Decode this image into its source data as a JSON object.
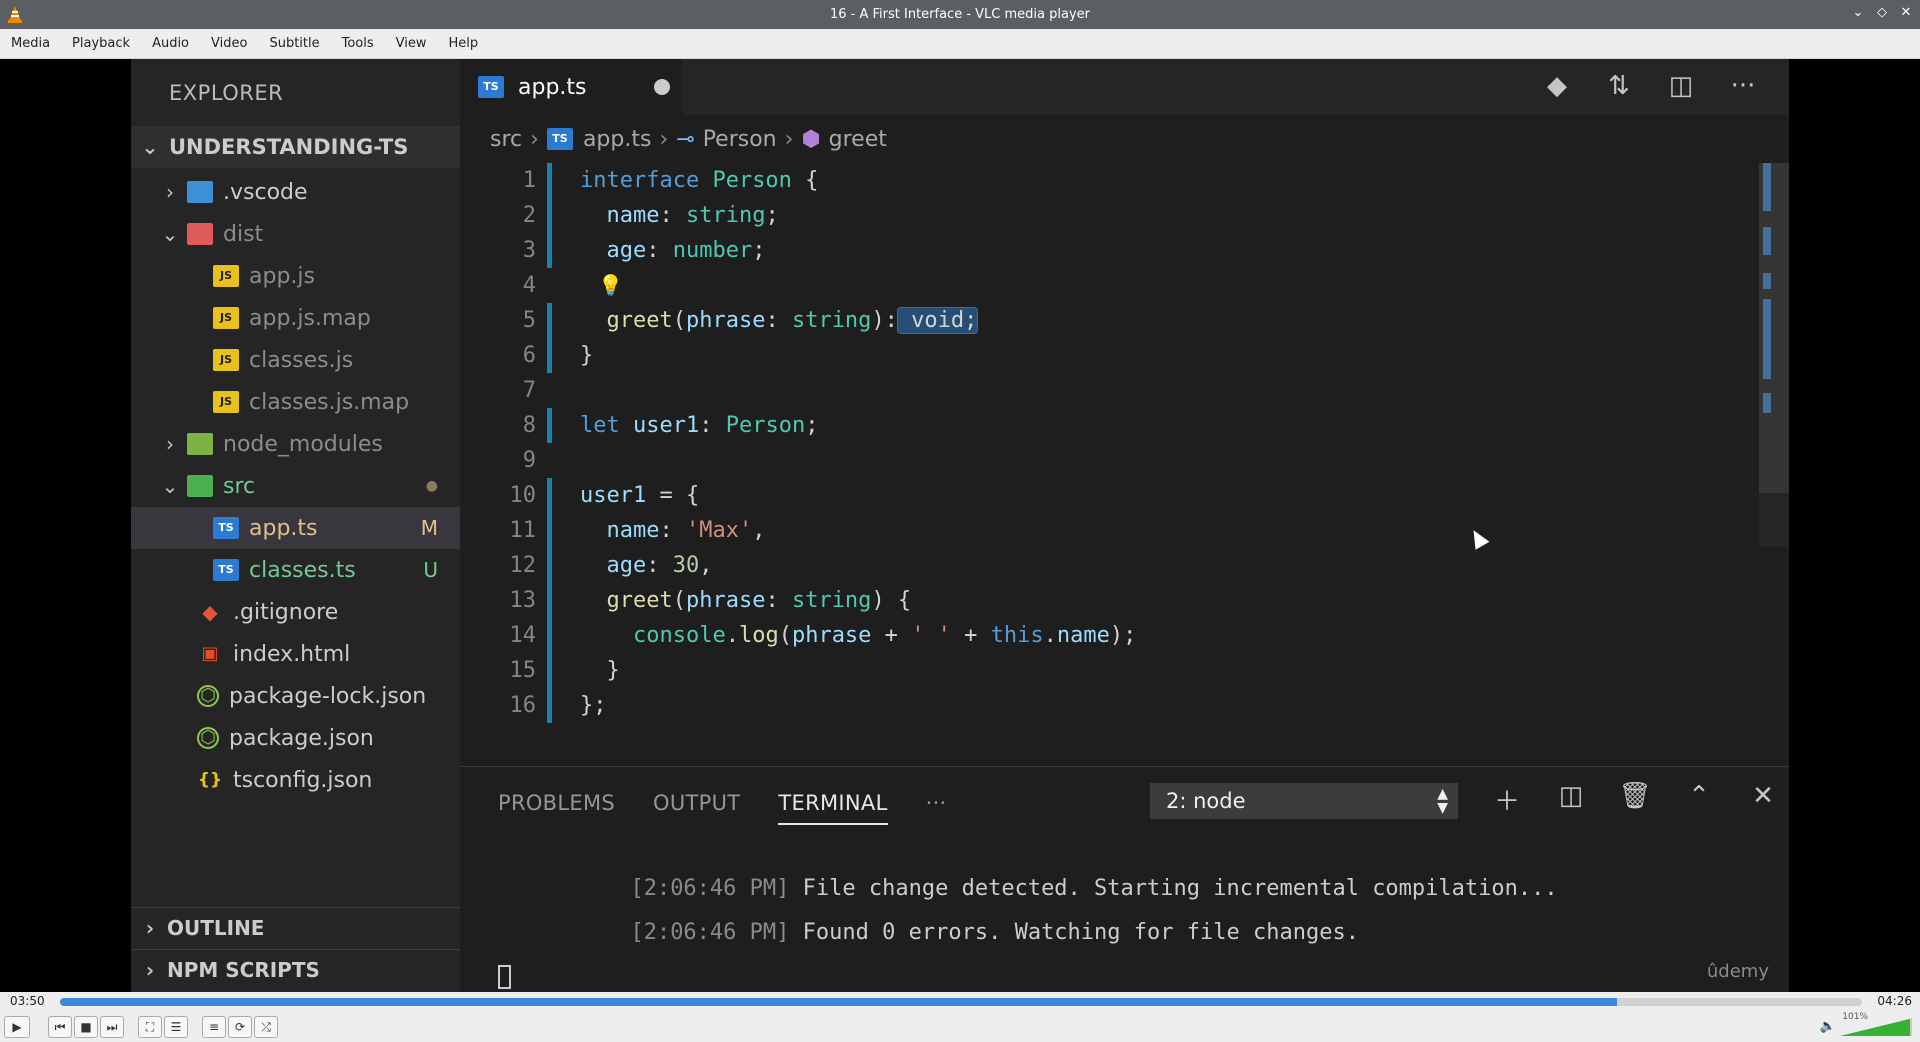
{
  "window": {
    "title": "16 - A First Interface - VLC media player",
    "buttons": [
      "minimize",
      "restore",
      "close"
    ]
  },
  "menu": [
    "Media",
    "Playback",
    "Audio",
    "Video",
    "Subtitle",
    "Tools",
    "View",
    "Help"
  ],
  "vscode": {
    "explorer_title": "EXPLORER",
    "root": "UNDERSTANDING-TS",
    "tree": [
      {
        "label": ".vscode",
        "icon": "vscode-folder-icon",
        "kind": "folder-collapsed"
      },
      {
        "label": "dist",
        "icon": "dist-folder-icon",
        "kind": "folder-open"
      },
      {
        "label": "app.js",
        "icon": "js-file-icon",
        "kind": "file"
      },
      {
        "label": "app.js.map",
        "icon": "js-map-file-icon",
        "kind": "file"
      },
      {
        "label": "classes.js",
        "icon": "js-file-icon",
        "kind": "file"
      },
      {
        "label": "classes.js.map",
        "icon": "js-map-file-icon",
        "kind": "file"
      },
      {
        "label": "node_modules",
        "icon": "node-folder-icon",
        "kind": "folder-collapsed"
      },
      {
        "label": "src",
        "icon": "src-folder-icon",
        "kind": "folder-open"
      },
      {
        "label": "app.ts",
        "icon": "ts-file-icon",
        "kind": "file",
        "badge": "M"
      },
      {
        "label": "classes.ts",
        "icon": "ts-file-icon",
        "kind": "file",
        "badge": "U"
      },
      {
        "label": ".gitignore",
        "icon": "git-icon",
        "kind": "file"
      },
      {
        "label": "index.html",
        "icon": "html-icon",
        "kind": "file"
      },
      {
        "label": "package-lock.json",
        "icon": "node-icon",
        "kind": "file"
      },
      {
        "label": "package.json",
        "icon": "node-icon",
        "kind": "file"
      },
      {
        "label": "tsconfig.json",
        "icon": "json-icon",
        "kind": "file"
      }
    ],
    "sections": [
      "OUTLINE",
      "NPM SCRIPTS"
    ],
    "tab": {
      "label": "app.ts",
      "icon_text": "TS"
    },
    "icon_texts": {
      "js": "JS",
      "ts": "TS"
    },
    "breadcrumb": [
      "src",
      "app.ts",
      "Person",
      "greet"
    ],
    "code_lines": [
      {
        "n": "1",
        "tokens": [
          [
            "kw",
            "interface "
          ],
          [
            "type",
            "Person"
          ],
          [
            "",
            " {"
          ]
        ]
      },
      {
        "n": "2",
        "tokens": [
          [
            "prop",
            "  name"
          ],
          [
            "",
            ": "
          ],
          [
            "type",
            "string"
          ],
          [
            "",
            ";"
          ]
        ]
      },
      {
        "n": "3",
        "tokens": [
          [
            "prop",
            "  age"
          ],
          [
            "",
            ": "
          ],
          [
            "type",
            "number"
          ],
          [
            "",
            ";"
          ]
        ]
      },
      {
        "n": "4",
        "tokens": []
      },
      {
        "n": "5",
        "tokens": [
          [
            "fn",
            "  greet"
          ],
          [
            "",
            "("
          ],
          [
            "prop",
            "phrase"
          ],
          [
            "",
            ": "
          ],
          [
            "type",
            "string"
          ],
          [
            "",
            "):"
          ],
          [
            "hl",
            " void;"
          ]
        ]
      },
      {
        "n": "6",
        "tokens": [
          [
            "",
            "}"
          ]
        ]
      },
      {
        "n": "7",
        "tokens": []
      },
      {
        "n": "8",
        "tokens": [
          [
            "kw",
            "let "
          ],
          [
            "prop",
            "user1"
          ],
          [
            "",
            ": "
          ],
          [
            "type",
            "Person"
          ],
          [
            "",
            ";"
          ]
        ]
      },
      {
        "n": "9",
        "tokens": []
      },
      {
        "n": "10",
        "tokens": [
          [
            "prop",
            "user1"
          ],
          [
            "",
            " = {"
          ]
        ]
      },
      {
        "n": "11",
        "tokens": [
          [
            "prop",
            "  name"
          ],
          [
            "",
            ": "
          ],
          [
            "str",
            "'Max'"
          ],
          [
            "",
            ","
          ]
        ]
      },
      {
        "n": "12",
        "tokens": [
          [
            "prop",
            "  age"
          ],
          [
            "",
            ": "
          ],
          [
            "num",
            "30"
          ],
          [
            "",
            ","
          ]
        ]
      },
      {
        "n": "13",
        "tokens": [
          [
            "fn",
            "  greet"
          ],
          [
            "",
            "("
          ],
          [
            "prop",
            "phrase"
          ],
          [
            "",
            ": "
          ],
          [
            "type",
            "string"
          ],
          [
            "",
            ") {"
          ]
        ]
      },
      {
        "n": "14",
        "tokens": [
          [
            "type",
            "    console"
          ],
          [
            "",
            "."
          ],
          [
            "fn",
            "log"
          ],
          [
            "",
            "("
          ],
          [
            "prop",
            "phrase"
          ],
          [
            "",
            " + "
          ],
          [
            "str",
            "' '"
          ],
          [
            "",
            " + "
          ],
          [
            "kw",
            "this"
          ],
          [
            "",
            "."
          ],
          [
            "prop",
            "name"
          ],
          [
            "",
            ");"
          ]
        ]
      },
      {
        "n": "15",
        "tokens": [
          [
            "",
            "  }"
          ]
        ]
      },
      {
        "n": "16",
        "tokens": [
          [
            "",
            "};"
          ]
        ]
      }
    ],
    "panel": {
      "tabs": [
        "PROBLEMS",
        "OUTPUT",
        "TERMINAL"
      ],
      "active_tab": "TERMINAL",
      "more": "···",
      "terminal_select": "2: node",
      "lines": [
        {
          "time": "[2:06:46 PM]",
          "text": " File change detected. Starting incremental compilation..."
        },
        {
          "time": "[2:06:46 PM]",
          "text": " Found 0 errors. Watching for file changes."
        }
      ],
      "watermark": "ûdemy"
    }
  },
  "player": {
    "elapsed": "03:50",
    "total": "04:26",
    "progress_fraction": 0.864,
    "volume_label": "101%",
    "accent": "#3f87d9"
  }
}
